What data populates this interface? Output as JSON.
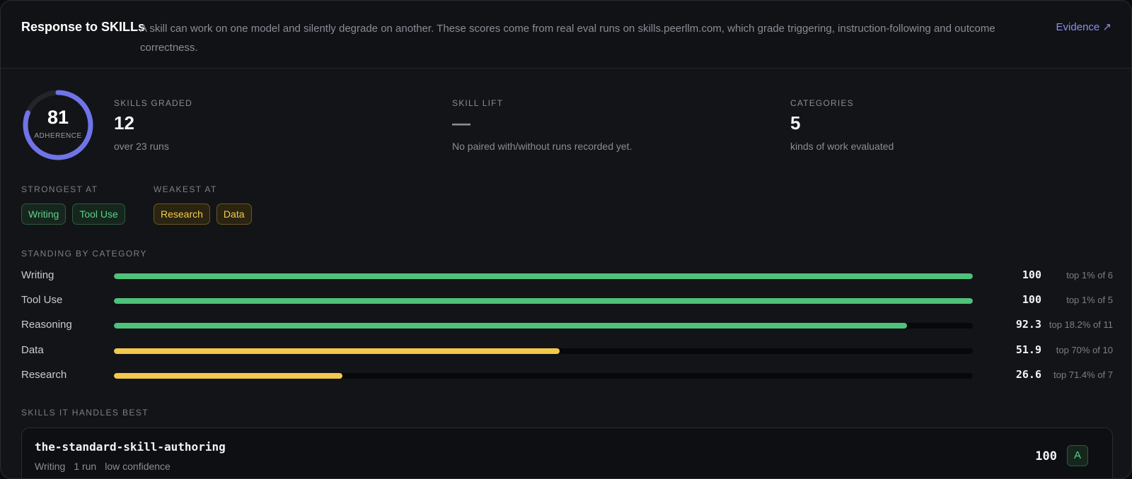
{
  "header": {
    "title": "Response to SKILLs",
    "description": "A skill can work on one model and silently degrade on another. These scores come from real eval runs on skills.peerllm.com, which grade triggering, instruction-following and outcome correctness.",
    "evidence_link": "Evidence ↗"
  },
  "adherence": {
    "value": "81",
    "label": "ADHERENCE",
    "fraction": 0.81,
    "color": "#6f74e8"
  },
  "stats": [
    {
      "key": "SKILLS GRADED",
      "value": "12",
      "sub": "over 23 runs"
    },
    {
      "key": "SKILL LIFT",
      "value": "—",
      "sub": "No paired with/without runs recorded yet."
    },
    {
      "key": "CATEGORIES",
      "value": "5",
      "sub": "kinds of work evaluated"
    }
  ],
  "strongest": {
    "label": "STRONGEST AT",
    "chips": [
      "Writing",
      "Tool Use"
    ]
  },
  "weakest": {
    "label": "WEAKEST AT",
    "chips": [
      "Research",
      "Data"
    ]
  },
  "standing": {
    "label": "STANDING BY CATEGORY",
    "rows": [
      {
        "name": "Writing",
        "score": "100",
        "value": 100,
        "rank": "top 1% of 6",
        "color": "#4fc27a"
      },
      {
        "name": "Tool Use",
        "score": "100",
        "value": 100,
        "rank": "top 1% of 5",
        "color": "#4fc27a"
      },
      {
        "name": "Reasoning",
        "score": "92.3",
        "value": 92.3,
        "rank": "top 18.2% of 11",
        "color": "#4fc27a"
      },
      {
        "name": "Data",
        "score": "51.9",
        "value": 51.9,
        "rank": "top 70% of 10",
        "color": "#f2c94c"
      },
      {
        "name": "Research",
        "score": "26.6",
        "value": 26.6,
        "rank": "top 71.4% of 7",
        "color": "#f2c94c"
      }
    ]
  },
  "best_skills": {
    "label": "SKILLS IT HANDLES BEST",
    "items": [
      {
        "name": "the-standard-skill-authoring",
        "category": "Writing",
        "runs": "1 run",
        "confidence": "low confidence",
        "score": "100",
        "grade": "A"
      }
    ]
  }
}
